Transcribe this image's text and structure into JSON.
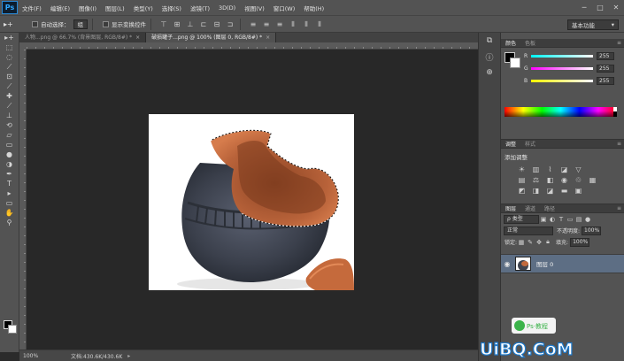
{
  "app": {
    "logo": "Ps"
  },
  "menu": [
    "文件(F)",
    "编辑(E)",
    "图像(I)",
    "图层(L)",
    "类型(Y)",
    "选择(S)",
    "滤镜(T)",
    "3D(D)",
    "视图(V)",
    "窗口(W)",
    "帮助(H)"
  ],
  "window_controls": {
    "minimize": "─",
    "restore": "□",
    "close": "✕"
  },
  "options": {
    "tool_glyph": "▸+",
    "auto_select_label": "自动选择：",
    "auto_select_value": "组",
    "show_transform_label": "显示变换控件",
    "workspace": "基本功能"
  },
  "doc_tabs": [
    {
      "label": "人物...png @ 66.7% (背景图层, RGB/8#) *",
      "close": "×",
      "active": false
    },
    {
      "label": "破损罐子...png @ 100% (图层 0, RGB/8#) *",
      "close": "×",
      "active": true
    }
  ],
  "status": {
    "zoom": "100%",
    "doc_info": "文档:430.6K/430.6K",
    "arrow": "▸"
  },
  "color_panel": {
    "tabs": [
      "颜色",
      "色板"
    ],
    "channels": [
      {
        "label": "R",
        "value": "255"
      },
      {
        "label": "G",
        "value": "255"
      },
      {
        "label": "B",
        "value": "255"
      }
    ]
  },
  "adjustments_panel": {
    "tabs": [
      "调整",
      "样式"
    ],
    "title": "添加调整"
  },
  "layers_panel": {
    "tabs": [
      "图层",
      "通道",
      "路径"
    ],
    "filter_kind": "ρ 类型",
    "blend_mode": "正常",
    "opacity_label": "不透明度:",
    "opacity_value": "100%",
    "lock_label": "锁定:",
    "fill_label": "填充:",
    "fill_value": "100%",
    "layers": [
      {
        "name": "图层 0",
        "visible_icon": "◉",
        "selected": true
      }
    ]
  },
  "watermark": {
    "brand": "UiBQ.CoM",
    "badge_text": "Ps·教程"
  },
  "colors": {
    "chrome": "#535353",
    "canvas_bg": "#282828",
    "selected_layer": "#5d6e84",
    "pot_body": "#3f4450",
    "pot_interior": "#c26a3e"
  }
}
